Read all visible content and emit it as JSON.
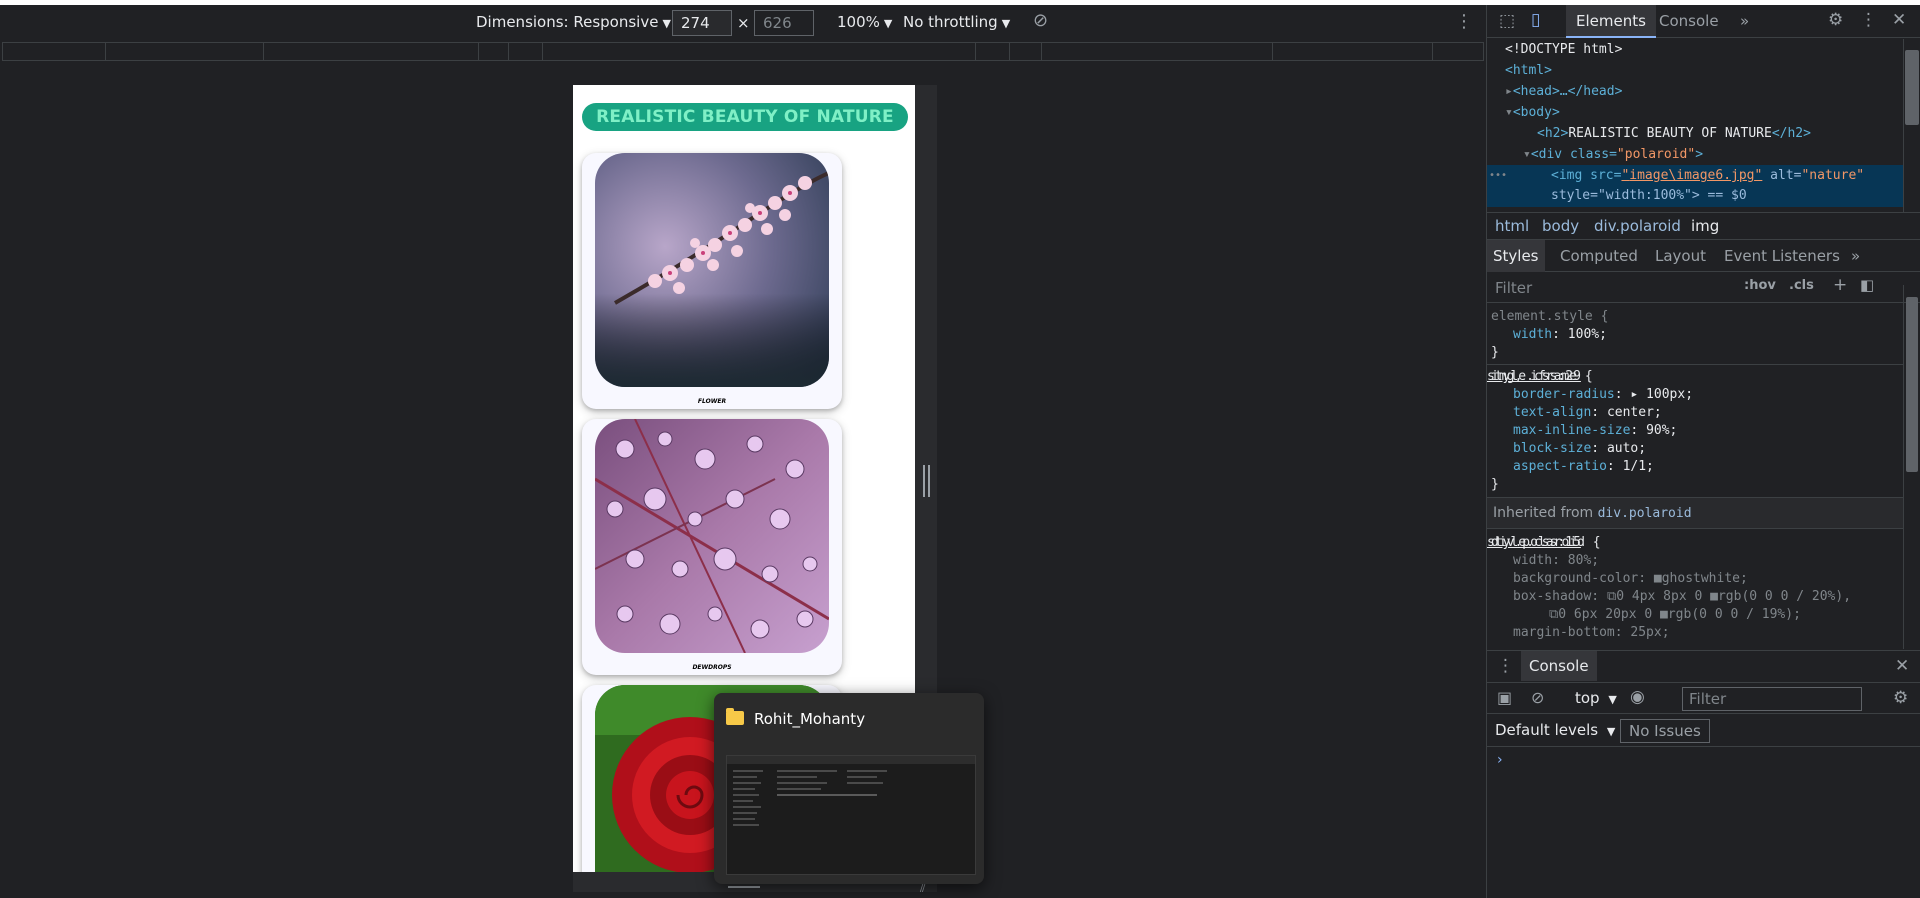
{
  "device_toolbar": {
    "dimensions_label": "Dimensions: Responsive",
    "width": "274",
    "height": "626",
    "times": "×",
    "zoom": "100%",
    "throttling": "No throttling"
  },
  "page": {
    "heading": "REALISTIC BEAUTY OF NATURE",
    "cards": [
      {
        "caption": "FLOWER",
        "image": "cherry-blossom"
      },
      {
        "caption": "DEWDROPS",
        "image": "dewdrops-leaf"
      },
      {
        "caption": "",
        "image": "red-rose"
      }
    ]
  },
  "taskbar_preview": {
    "title": "Rohit_Mohanty",
    "icon": "folder-icon"
  },
  "devtools": {
    "tabs": [
      "Elements",
      "Console",
      "»"
    ],
    "dom": {
      "doctype": "<!DOCTYPE html>",
      "html_open": "<html>",
      "head": "<head>…</head>",
      "body_open": "<body>",
      "h2_open": "<h2>",
      "h2_text": "REALISTIC BEAUTY OF NATURE",
      "h2_close": "</h2>",
      "div_tag": "<div class=",
      "div_class": "\"polaroid\"",
      "div_end": ">",
      "img_open": "<img src=",
      "img_src": "image\\image6.jpg",
      "img_alt_attr": " alt=",
      "img_alt": "\"nature\"",
      "img_style": "style=\"width:100%\"> == $0",
      "ellipsis": "•••"
    },
    "breadcrumbs": [
      "html",
      "body",
      "div.polaroid",
      "img"
    ],
    "subtabs": [
      "Styles",
      "Computed",
      "Layout",
      "Event Listeners",
      "»"
    ],
    "filter_placeholder": "Filter",
    "hov": ":hov",
    "cls": ".cls",
    "styles": {
      "element_style_selector": "element.style {",
      "element_style_prop": "width",
      "element_style_val": "100%;",
      "close": "}",
      "rule2_selector": "img, iframe {",
      "rule2_source": "style.css:29",
      "rule2_props": [
        {
          "prop": "border-radius",
          "val": "▸ 100px;"
        },
        {
          "prop": "text-align",
          "val": "center;"
        },
        {
          "prop": "max-inline-size",
          "val": "90%;"
        },
        {
          "prop": "block-size",
          "val": "auto;"
        },
        {
          "prop": "aspect-ratio",
          "val": "1/1;"
        }
      ],
      "inherited_label": "Inherited from",
      "inherited_from": "div.polaroid",
      "rule3_selector": "div.polaroid {",
      "rule3_source": "style.css:15",
      "rule3_props": [
        {
          "prop": "width",
          "val": "80%;"
        },
        {
          "prop": "background-color",
          "val": "■ghostwhite;"
        },
        {
          "prop": "box-shadow",
          "val": "⧉0 4px 8px 0 ■rgb(0 0 0 / 20%),"
        },
        {
          "prop": "",
          "val": "⧉0 6px 20px 0 ■rgb(0 0 0 / 19%);"
        },
        {
          "prop": "margin-bottom",
          "val": "25px;"
        }
      ]
    },
    "console": {
      "tab_label": "Console",
      "context": "top",
      "filter_placeholder": "Filter",
      "levels": "Default levels",
      "no_issues": "No Issues",
      "prompt": "›"
    }
  },
  "colors": {
    "heading_bg": "#18a382",
    "heading_text": "#7ff0c6",
    "card_bg": "#f8f8ff",
    "devtools_bg": "#202124"
  }
}
